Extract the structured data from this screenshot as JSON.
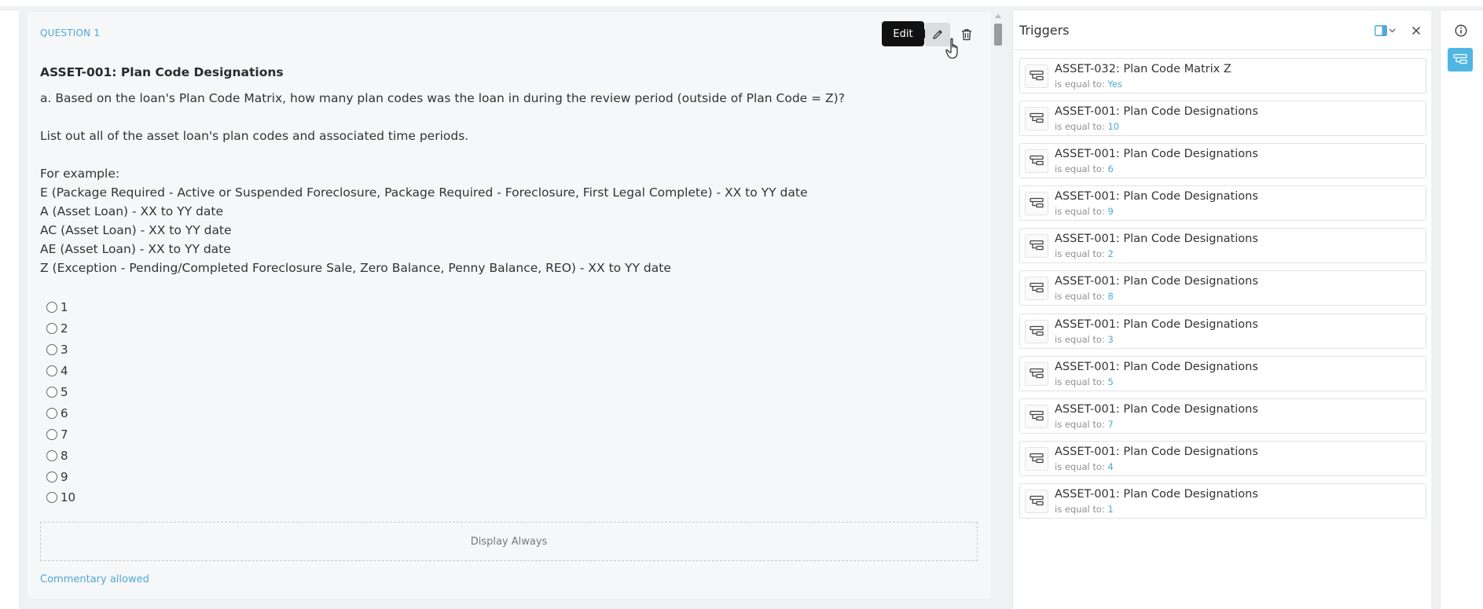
{
  "question": {
    "label": "QUESTION 1",
    "title": "ASSET-001: Plan Code Designations",
    "lines": [
      "a. Based on the loan's Plan Code Matrix, how many plan codes was the loan in during the review period (outside of Plan Code = Z)?",
      "",
      "List out all of the asset loan's plan codes and associated time periods.",
      "",
      "For example:",
      "E (Package Required - Active or Suspended Foreclosure, Package Required - Foreclosure, First Legal Complete) - XX to YY date",
      "A (Asset Loan) - XX to YY date",
      "AC (Asset Loan) - XX to YY date",
      "AE (Asset Loan) - XX to YY date",
      "Z (Exception - Pending/Completed Foreclosure Sale, Zero Balance, Penny Balance, REO) - XX to YY date"
    ],
    "options": [
      "1",
      "2",
      "3",
      "4",
      "5",
      "6",
      "7",
      "8",
      "9",
      "10"
    ],
    "display_rule": "Display Always",
    "commentary": "Commentary allowed"
  },
  "toolbar": {
    "edit_tooltip": "Edit",
    "edit_icon": "pencil-icon",
    "delete_icon": "trash-icon"
  },
  "triggers": {
    "title": "Triggers",
    "condition_prefix": "is equal to:",
    "items": [
      {
        "name": "ASSET-032: Plan Code Matrix Z",
        "value": "Yes"
      },
      {
        "name": "ASSET-001: Plan Code Designations",
        "value": "10"
      },
      {
        "name": "ASSET-001: Plan Code Designations",
        "value": "6"
      },
      {
        "name": "ASSET-001: Plan Code Designations",
        "value": "9"
      },
      {
        "name": "ASSET-001: Plan Code Designations",
        "value": "2"
      },
      {
        "name": "ASSET-001: Plan Code Designations",
        "value": "8"
      },
      {
        "name": "ASSET-001: Plan Code Designations",
        "value": "3"
      },
      {
        "name": "ASSET-001: Plan Code Designations",
        "value": "5"
      },
      {
        "name": "ASSET-001: Plan Code Designations",
        "value": "7"
      },
      {
        "name": "ASSET-001: Plan Code Designations",
        "value": "4"
      },
      {
        "name": "ASSET-001: Plan Code Designations",
        "value": "1"
      }
    ]
  },
  "colors": {
    "accent": "#4fa9d6",
    "rail_active": "#4fb6e3"
  }
}
